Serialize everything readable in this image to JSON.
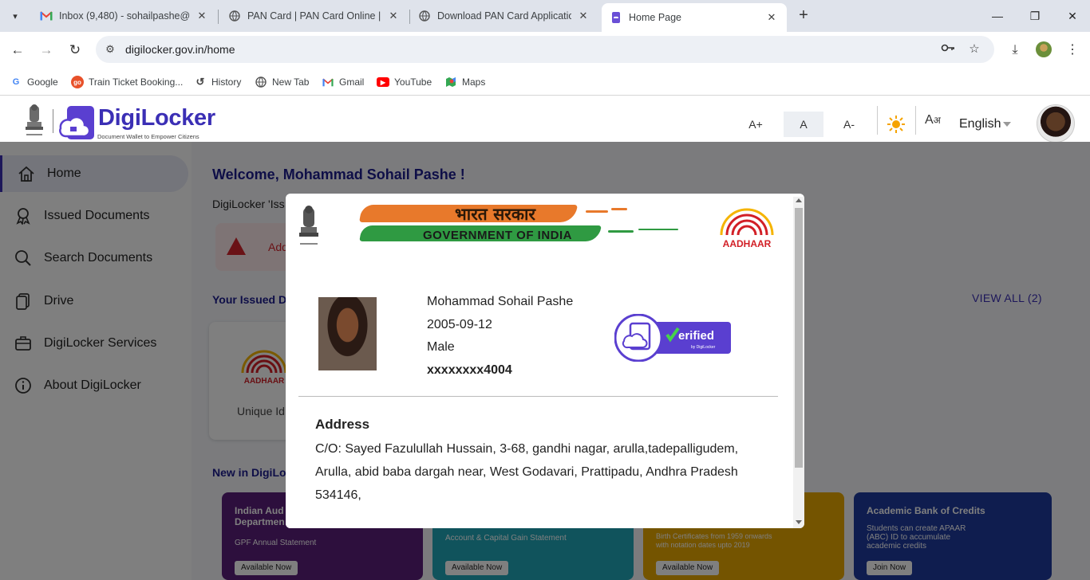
{
  "browser": {
    "tabs": [
      {
        "title": "Inbox (9,480) - sohailpashe@gm",
        "icon": "gmail-icon"
      },
      {
        "title": "PAN Card | PAN Card Online | P",
        "icon": "globe-icon"
      },
      {
        "title": "Download PAN Card Application",
        "icon": "globe-icon"
      },
      {
        "title": "Home Page",
        "icon": "digilocker-icon"
      }
    ],
    "url": "digilocker.gov.in/home",
    "bookmarks": [
      {
        "label": "Google",
        "icon": "google-icon"
      },
      {
        "label": "Train Ticket Booking...",
        "icon": "goibibo-icon"
      },
      {
        "label": "History",
        "icon": "history-icon"
      },
      {
        "label": "New Tab",
        "icon": "globe-icon"
      },
      {
        "label": "Gmail",
        "icon": "gmail-icon"
      },
      {
        "label": "YouTube",
        "icon": "youtube-icon"
      },
      {
        "label": "Maps",
        "icon": "maps-icon"
      }
    ]
  },
  "header": {
    "brand": "DigiLocker",
    "tagline": "Document Wallet to Empower Citizens",
    "font_increase": "A+",
    "font_normal": "A",
    "font_decrease": "A-",
    "language": "English"
  },
  "sidebar": {
    "items": [
      {
        "label": "Home",
        "icon": "home-icon"
      },
      {
        "label": "Issued Documents",
        "icon": "award-icon"
      },
      {
        "label": "Search Documents",
        "icon": "search-icon"
      },
      {
        "label": "Drive",
        "icon": "files-icon"
      },
      {
        "label": "DigiLocker Services",
        "icon": "briefcase-icon"
      },
      {
        "label": "About DigiLocker",
        "icon": "info-icon"
      }
    ]
  },
  "main": {
    "welcome": "Welcome, Mohammad Sohail Pashe !",
    "issued_text": "DigiLocker 'Iss",
    "alert_text": "Add",
    "your_issued": "Your Issued D",
    "view_all": "VIEW ALL (2)",
    "doc_card_label": "Unique Id",
    "new_in": "New in DigiLo",
    "promos": [
      {
        "title": "Indian Aud\nDepartmen",
        "sub": "GPF Annual Statement",
        "button": "Available Now",
        "color": "#5b1e7a"
      },
      {
        "title": "",
        "sub": "Account & Capital Gain Statement",
        "button": "Available Now",
        "color": "#20a6b8"
      },
      {
        "title": "",
        "sub": "Birth Certificates from 1959 onwards\nwith notation dates upto 2019",
        "button": "Available Now",
        "color": "#e8a800"
      },
      {
        "title": "Academic Bank of Credits",
        "sub": "Students can create APAAR\n(ABC) ID to accumulate\nacademic credits",
        "button": "Join Now",
        "color": "#1f3a9e"
      }
    ]
  },
  "modal": {
    "banner_hindi": "भारत सरकार",
    "banner_english": "GOVERNMENT OF INDIA",
    "aadhaar_brand": "AADHAAR",
    "name": "Mohammad Sohail Pashe",
    "dob": "2005-09-12",
    "gender": "Male",
    "aadhaar_number": "xxxxxxxx4004",
    "verified_label": "erified",
    "verified_sub": "by DigiLocker",
    "address_label": "Address",
    "address": "C/O: Sayed Fazulullah Hussain, 3-68, gandhi nagar, arulla,tadepalligudem, Arulla, abid baba dargah near, West Godavari, Prattipadu, Andhra Pradesh 534146,"
  }
}
